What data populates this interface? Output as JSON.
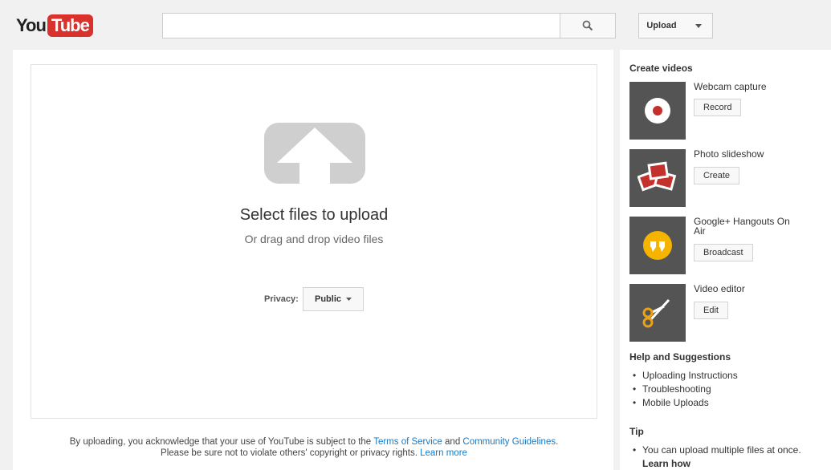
{
  "header": {
    "logo_you": "You",
    "logo_tube": "Tube",
    "search_placeholder": "",
    "upload_label": "Upload"
  },
  "main": {
    "title": "Select files to upload",
    "subtitle": "Or drag and drop video files",
    "privacy_label": "Privacy:",
    "privacy_value": "Public",
    "tos": {
      "prefix": "By uploading, you acknowledge that your use of YouTube is subject to the ",
      "terms_link": "Terms of Service",
      "and": " and ",
      "guidelines_link": "Community Guidelines",
      "period": ".",
      "line2": "Please be sure not to violate others' copyright or privacy rights. ",
      "learn_link": "Learn more"
    }
  },
  "sidebar": {
    "create_heading": "Create videos",
    "tools": [
      {
        "name": "Webcam capture",
        "button": "Record",
        "icon": "record-icon"
      },
      {
        "name": "Photo slideshow",
        "button": "Create",
        "icon": "slideshow-icon"
      },
      {
        "name": "Google+ Hangouts On Air",
        "button": "Broadcast",
        "icon": "hangouts-icon"
      },
      {
        "name": "Video editor",
        "button": "Edit",
        "icon": "scissors-icon"
      }
    ],
    "help_heading": "Help and Suggestions",
    "help_links": [
      "Uploading Instructions",
      "Troubleshooting",
      "Mobile Uploads"
    ],
    "tip_heading": "Tip",
    "tip_text": "You can upload multiple files at once.",
    "tip_link": "Learn how"
  },
  "colors": {
    "brand_red": "#d9312b",
    "link_blue": "#167ac6",
    "hangouts_yellow": "#f4b400",
    "thumb_bg": "#545454"
  }
}
